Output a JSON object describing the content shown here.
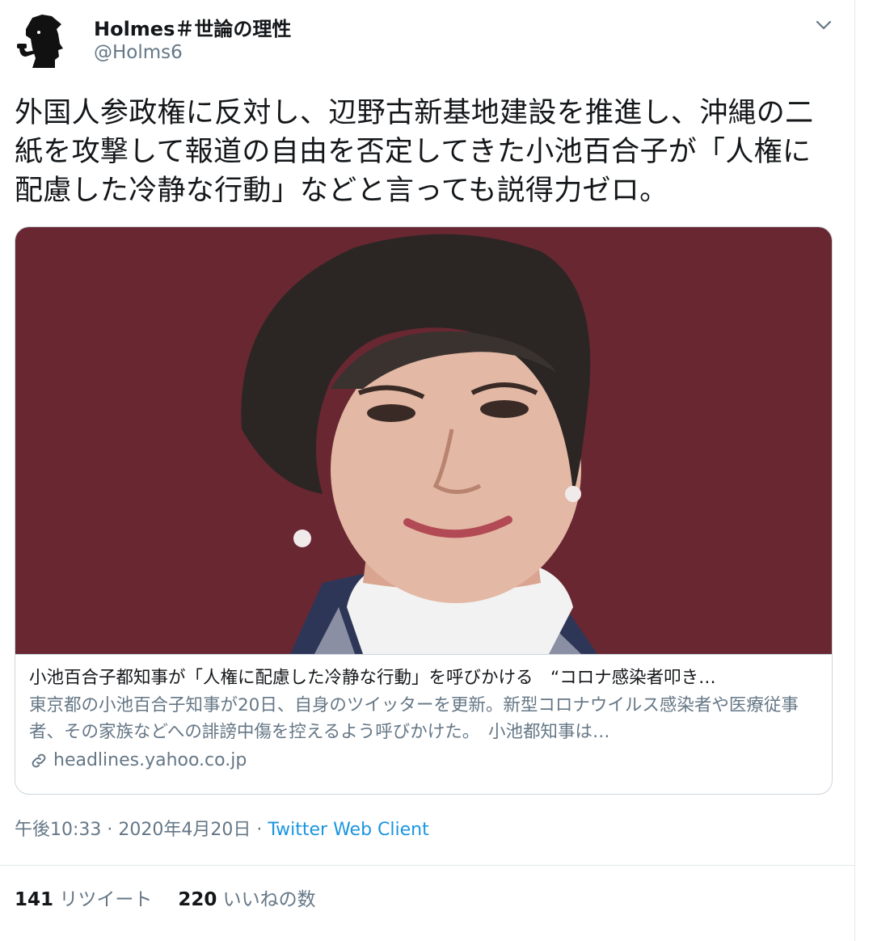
{
  "author": {
    "display_name": "Holmes＃世論の理性",
    "handle": "@Holms6",
    "avatar_icon": "sherlock-silhouette-icon"
  },
  "tweet": {
    "text": "外国人参政権に反対し、辺野古新基地建設を推進し、沖縄の二紙を攻撃して報道の自由を否定してきた小池百合子が「人権に配慮した冷静な行動」などと言っても説得力ゼロ。"
  },
  "card": {
    "title": "小池百合子都知事が「人権に配慮した冷静な行動」を呼びかける　“コロナ感染者叩き…",
    "description": "東京都の小池百合子知事が20日、自身のツイッターを更新。新型コロナウイルス感染者や医療従事者、その家族などへの誹謗中傷を控えるよう呼びかけた。　小池都知事は…",
    "domain": "headlines.yahoo.co.jp",
    "image_icon": "woman-portrait-photo"
  },
  "meta": {
    "time": "午後10:33",
    "sep1": " · ",
    "date": "2020年4月20日",
    "sep2": " · ",
    "source": "Twitter Web Client"
  },
  "stats": {
    "retweets_count": "141",
    "retweets_label": "リツイート",
    "likes_count": "220",
    "likes_label": "いいねの数"
  },
  "colors": {
    "link": "#1b95e0",
    "secondary_text": "#657786",
    "border": "#ccd6dd",
    "photo_background": "#6e2a34"
  }
}
